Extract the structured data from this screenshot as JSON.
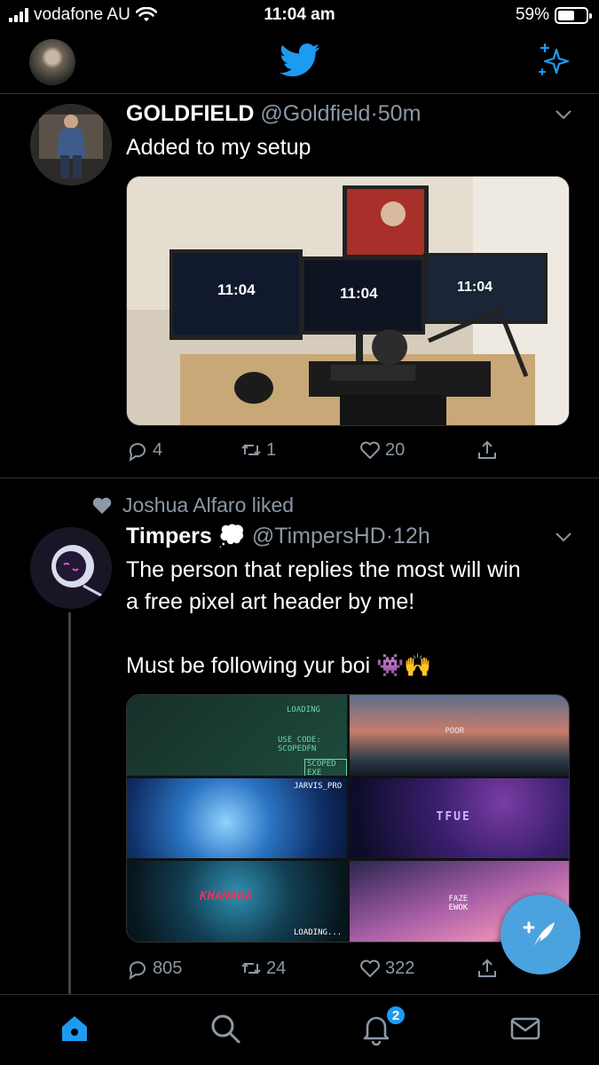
{
  "status_bar": {
    "carrier": "vodafone AU",
    "time": "11:04 am",
    "battery": "59%",
    "battery_level": 0.59
  },
  "top_nav": {
    "logo_icon": "twitter-bird-icon",
    "sparkle_icon": "sparkle-icon"
  },
  "colors": {
    "accent": "#1d9bf0",
    "fab": "#4aa3df",
    "secondary_text": "#8b98a5"
  },
  "tweets": [
    {
      "name": "GOLDFIELD",
      "handle": "@Goldfield",
      "separator": "·",
      "time": "50m",
      "text": "Added to my setup",
      "media": {
        "monitor_clock_1": "11:04",
        "monitor_clock_2": "11:04",
        "monitor_clock_3": "11:04"
      },
      "actions": {
        "replies": "4",
        "retweets": "1",
        "likes": "20"
      }
    },
    {
      "liked_by": "Joshua Alfaro liked",
      "name": "Timpers",
      "name_emoji": "💭",
      "handle": "@TimpersHD",
      "separator": "·",
      "time": "12h",
      "text": "The person that replies the most will win\na free pixel art header by me!\n\nMust be following yur boi 👾🙌",
      "media": {
        "tile_1_label": "USE CODE: SCOPEDFN",
        "tile_1_label_b": "SCOPED EXE",
        "tile_1_label_c": "LOADING",
        "tile_2_label": "POOR",
        "tile_3_label": "JARVIS_PRO",
        "tile_4_label": "TFUE",
        "tile_5_label": "KHANADA",
        "tile_5_label_b": "LOADING...",
        "tile_6_label": "FAZE EWOK"
      },
      "actions": {
        "replies": "805",
        "retweets": "24",
        "likes": "322"
      }
    }
  ],
  "tab_bar": {
    "notifications_badge": "2"
  }
}
